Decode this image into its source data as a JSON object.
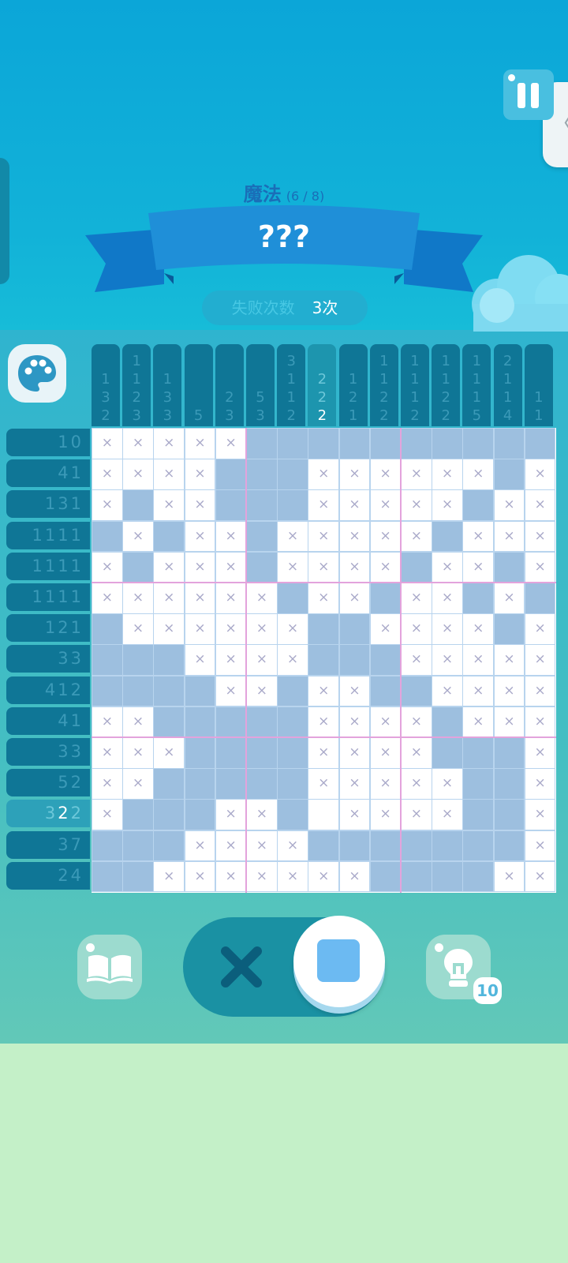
{
  "header": {
    "chapter": "魔法",
    "progress": "(6 / 8)",
    "puzzle_name": "???",
    "fail_label": "失败次数",
    "fail_value": "3次"
  },
  "colors": {
    "filled_cell": "#9dbfdf",
    "clue_bg": "#0f7696",
    "clue_text": "#3b9ab8",
    "accent_blue": "#6cbaf2"
  },
  "icons": {
    "palette": "palette-icon",
    "pause": "pause-icon",
    "book": "book-icon",
    "hint": "lightbulb-icon",
    "cross_mode": "cross-icon",
    "fill_mode": "square-icon"
  },
  "highlight": {
    "row": 12,
    "col": 7
  },
  "column_clues": [
    [
      "1",
      "3",
      "2"
    ],
    [
      "1",
      "1",
      "2",
      "3"
    ],
    [
      "1",
      "3",
      "3"
    ],
    [
      "5"
    ],
    [
      "2",
      "3"
    ],
    [
      "5",
      "3"
    ],
    [
      "3",
      "1",
      "1",
      "2"
    ],
    [
      "2",
      "2",
      "2"
    ],
    [
      "1",
      "2",
      "1"
    ],
    [
      "1",
      "1",
      "2",
      "2"
    ],
    [
      "1",
      "1",
      "1",
      "2"
    ],
    [
      "1",
      "1",
      "2",
      "2"
    ],
    [
      "1",
      "1",
      "1",
      "5"
    ],
    [
      "2",
      "1",
      "1",
      "4"
    ],
    [
      "1",
      "1"
    ]
  ],
  "column_done": {
    "7": [
      2
    ]
  },
  "row_clues": [
    [
      "10"
    ],
    [
      "4",
      "1"
    ],
    [
      "1",
      "3",
      "1"
    ],
    [
      "1",
      "1",
      "1",
      "1"
    ],
    [
      "1",
      "1",
      "1",
      "1"
    ],
    [
      "1",
      "1",
      "1",
      "1"
    ],
    [
      "1",
      "2",
      "1"
    ],
    [
      "3",
      "3"
    ],
    [
      "4",
      "1",
      "2"
    ],
    [
      "4",
      "1"
    ],
    [
      "3",
      "3"
    ],
    [
      "5",
      "2"
    ],
    [
      "3",
      "2",
      "2"
    ],
    [
      "3",
      "7"
    ],
    [
      "2",
      "4"
    ]
  ],
  "row_done": {
    "12": [
      1
    ]
  },
  "grid_rows": [
    "xxxxx__________",
    "xxxx___xxxxxx_x",
    "x_xx___xxxxx_xx",
    "_x_xx_xxxxx_xxx",
    "x_xxx_xxxx_xx_x",
    "xxxxxx_xx_xx_x_",
    "_xxxxxx__xxxx_x",
    "___xxxx___xxxxx",
    "____xx_xx__xxxx",
    "xx_____xxxx_xxx",
    "xxx____xxxx___x",
    "xx_____xxxxx__x",
    "x___xx_.xxxx__x",
    "___xxxx_______x",
    "__xxxxxxx____xx"
  ],
  "controls": {
    "hint_count": "10"
  }
}
